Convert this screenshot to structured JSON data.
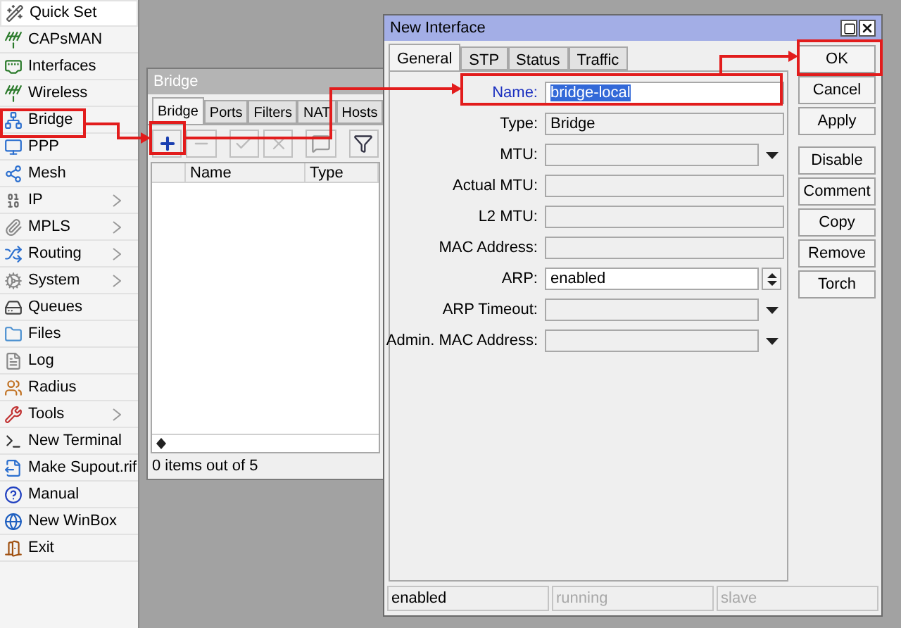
{
  "sidebar": {
    "items": [
      {
        "label": "Quick Set",
        "submenu": false,
        "selected": true
      },
      {
        "label": "CAPsMAN",
        "submenu": false,
        "selected": false
      },
      {
        "label": "Interfaces",
        "submenu": false,
        "selected": false
      },
      {
        "label": "Wireless",
        "submenu": false,
        "selected": false
      },
      {
        "label": "Bridge",
        "submenu": false,
        "selected": false
      },
      {
        "label": "PPP",
        "submenu": false,
        "selected": false
      },
      {
        "label": "Mesh",
        "submenu": false,
        "selected": false
      },
      {
        "label": "IP",
        "submenu": true,
        "selected": false
      },
      {
        "label": "MPLS",
        "submenu": true,
        "selected": false
      },
      {
        "label": "Routing",
        "submenu": true,
        "selected": false
      },
      {
        "label": "System",
        "submenu": true,
        "selected": false
      },
      {
        "label": "Queues",
        "submenu": false,
        "selected": false
      },
      {
        "label": "Files",
        "submenu": false,
        "selected": false
      },
      {
        "label": "Log",
        "submenu": false,
        "selected": false
      },
      {
        "label": "Radius",
        "submenu": false,
        "selected": false
      },
      {
        "label": "Tools",
        "submenu": true,
        "selected": false
      },
      {
        "label": "New Terminal",
        "submenu": false,
        "selected": false
      },
      {
        "label": "Make Supout.rif",
        "submenu": false,
        "selected": false
      },
      {
        "label": "Manual",
        "submenu": false,
        "selected": false
      },
      {
        "label": "New WinBox",
        "submenu": false,
        "selected": false
      },
      {
        "label": "Exit",
        "submenu": false,
        "selected": false
      }
    ]
  },
  "bridge_window": {
    "title": "Bridge",
    "active": false,
    "tabs": [
      {
        "label": "Bridge",
        "selected": true
      },
      {
        "label": "Ports",
        "selected": false
      },
      {
        "label": "Filters",
        "selected": false
      },
      {
        "label": "NAT",
        "selected": false
      },
      {
        "label": "Hosts",
        "selected": false
      }
    ],
    "columns": [
      "Name",
      "Type"
    ],
    "status": "0 items out of 5"
  },
  "dialog": {
    "title": "New Interface",
    "active": true,
    "tabs": [
      {
        "label": "General",
        "selected": true
      },
      {
        "label": "STP",
        "selected": false
      },
      {
        "label": "Status",
        "selected": false
      },
      {
        "label": "Traffic",
        "selected": false
      }
    ],
    "fields": [
      {
        "label": "Name:",
        "value": "bridge-local",
        "kind": "text",
        "focused": true
      },
      {
        "label": "Type:",
        "value": "Bridge",
        "kind": "readonly",
        "focused": false
      },
      {
        "label": "MTU:",
        "kind": "dropdown",
        "focused": false
      },
      {
        "label": "Actual MTU:",
        "kind": "readonly",
        "focused": false
      },
      {
        "label": "L2 MTU:",
        "kind": "readonly",
        "focused": false
      },
      {
        "label": "MAC Address:",
        "kind": "readonly",
        "focused": false
      },
      {
        "label": "ARP:",
        "value": "enabled",
        "kind": "combo",
        "focused": false
      },
      {
        "label": "ARP Timeout:",
        "kind": "dropdown",
        "focused": false
      },
      {
        "label": "Admin. MAC Address:",
        "kind": "dropdown",
        "focused": false
      }
    ],
    "button_groups": [
      [
        "OK",
        "Cancel",
        "Apply"
      ],
      [
        "Disable",
        "Comment",
        "Copy",
        "Remove",
        "Torch"
      ]
    ],
    "status_bar": [
      {
        "text": "enabled",
        "disabled": false
      },
      {
        "text": "running",
        "disabled": true
      },
      {
        "text": "slave",
        "disabled": true
      }
    ]
  }
}
